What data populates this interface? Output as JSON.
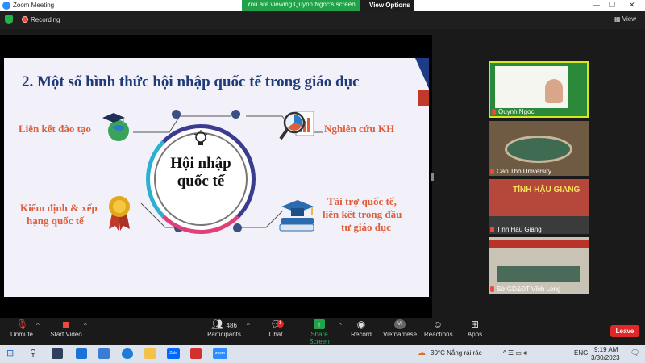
{
  "window": {
    "title": "Zoom Meeting",
    "icon": "zoom-icon"
  },
  "banner": {
    "viewing": "You are viewing Quynh Ngoc's screen",
    "view_options": "View Options"
  },
  "recording": {
    "label": "Recording"
  },
  "view_button": {
    "label": "View"
  },
  "slide": {
    "title": "2. Một số hình thức hội nhập quốc tế trong giáo dục",
    "hub_line1": "Hội nhập",
    "hub_line2": "quốc tế",
    "left_top": "Liên kết đào tạo",
    "left_bottom_1": "Kiểm định & xếp",
    "left_bottom_2": "hạng quốc tế",
    "right_top": "Nghiên cứu KH",
    "right_bottom_1": "Tài trợ quốc tế,",
    "right_bottom_2": "liên kết trong đầu",
    "right_bottom_3": "tư giáo dục"
  },
  "gallery": [
    {
      "name": "Quynh Ngoc"
    },
    {
      "name": "Can Tho University"
    },
    {
      "name": "Tinh Hau Giang",
      "sign": "TỈNH HẬU GIANG"
    },
    {
      "name": "Sở GD&ĐT Vĩnh Long"
    }
  ],
  "toolbar": {
    "unmute": "Unmute",
    "start_video": "Start Video",
    "participants": "Participants",
    "participants_count": "486",
    "chat": "Chat",
    "chat_badge": "1",
    "share_screen": "Share Screen",
    "record": "Record",
    "vietnamese": "Vietnamese",
    "vietnamese_badge": "VI",
    "reactions": "Reactions",
    "apps": "Apps",
    "leave": "Leave"
  },
  "taskbar": {
    "weather": "30°C  Nắng rải rác",
    "language": "ENG",
    "time": "9:19 AM",
    "date": "3/30/2023",
    "zalo": "Zalo",
    "zoom": "zoom"
  },
  "colors": {
    "accent_green": "#20a24a",
    "leave_red": "#e02828",
    "slide_title": "#1f3b7a",
    "slide_text": "#e05d3a"
  }
}
